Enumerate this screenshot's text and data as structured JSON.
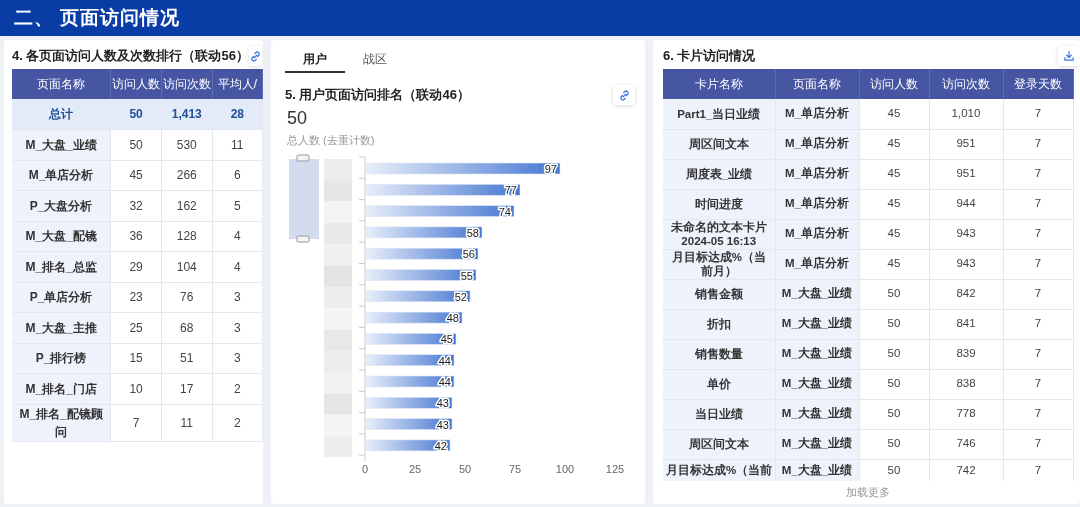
{
  "header": {
    "title": "二、 页面访问情况"
  },
  "page_table": {
    "title": "4. 各页面访问人数及次数排行（联动56）",
    "columns": [
      "页面名称",
      "访问人数",
      "访问次数",
      "平均人/"
    ],
    "total": [
      "总计",
      "50",
      "1,413",
      "28"
    ],
    "rows": [
      [
        "M_大盘_业绩",
        "50",
        "530",
        "11"
      ],
      [
        "M_单店分析",
        "45",
        "266",
        "6"
      ],
      [
        "P_大盘分析",
        "32",
        "162",
        "5"
      ],
      [
        "M_大盘_配镜",
        "36",
        "128",
        "4"
      ],
      [
        "M_排名_总监",
        "29",
        "104",
        "4"
      ],
      [
        "P_单店分析",
        "23",
        "76",
        "3"
      ],
      [
        "M_大盘_主推",
        "25",
        "68",
        "3"
      ],
      [
        "P_排行榜",
        "15",
        "51",
        "3"
      ],
      [
        "M_排名_门店",
        "10",
        "17",
        "2"
      ],
      [
        "M_排名_配镜顾问",
        "7",
        "11",
        "2"
      ]
    ]
  },
  "user_panel": {
    "tabs": [
      {
        "label": "用户",
        "selected": true
      },
      {
        "label": "战区",
        "selected": false
      }
    ],
    "title": "5. 用户页面访问排名（联动46）",
    "total_value": "50",
    "total_label": "总人数 (去重计数)",
    "chart_data": {
      "type": "bar",
      "orientation": "horizontal",
      "values": [
        97,
        77,
        74,
        58,
        56,
        55,
        52,
        48,
        45,
        44,
        44,
        43,
        43,
        42
      ],
      "xlim": [
        0,
        125
      ],
      "xticks": [
        0,
        25,
        50,
        75,
        100,
        125
      ],
      "data_labels": true
    }
  },
  "card_table": {
    "title": "6. 卡片访问情况",
    "columns": [
      "卡片名称",
      "页面名称",
      "访问人数",
      "访问次数",
      "登录天数"
    ],
    "rows": [
      [
        "Part1_当日业绩",
        "M_单店分析",
        "45",
        "1,010",
        "7"
      ],
      [
        "周区间文本",
        "M_单店分析",
        "45",
        "951",
        "7"
      ],
      [
        "周度表_业绩",
        "M_单店分析",
        "45",
        "951",
        "7"
      ],
      [
        "时间进度",
        "M_单店分析",
        "45",
        "944",
        "7"
      ],
      [
        "未命名的文本卡片 2024-05 16:13",
        "M_单店分析",
        "45",
        "943",
        "7"
      ],
      [
        "月目标达成%（当前月）",
        "M_单店分析",
        "45",
        "943",
        "7"
      ],
      [
        "销售金额",
        "M_大盘_业绩",
        "50",
        "842",
        "7"
      ],
      [
        "折扣",
        "M_大盘_业绩",
        "50",
        "841",
        "7"
      ],
      [
        "销售数量",
        "M_大盘_业绩",
        "50",
        "839",
        "7"
      ],
      [
        "单价",
        "M_大盘_业绩",
        "50",
        "838",
        "7"
      ],
      [
        "当日业绩",
        "M_大盘_业绩",
        "50",
        "778",
        "7"
      ],
      [
        "周区间文本",
        "M_大盘_业绩",
        "50",
        "746",
        "7"
      ],
      [
        "月目标达成%（当前",
        "M_大盘_业绩",
        "50",
        "742",
        "7"
      ]
    ],
    "load_more": "加载更多"
  }
}
